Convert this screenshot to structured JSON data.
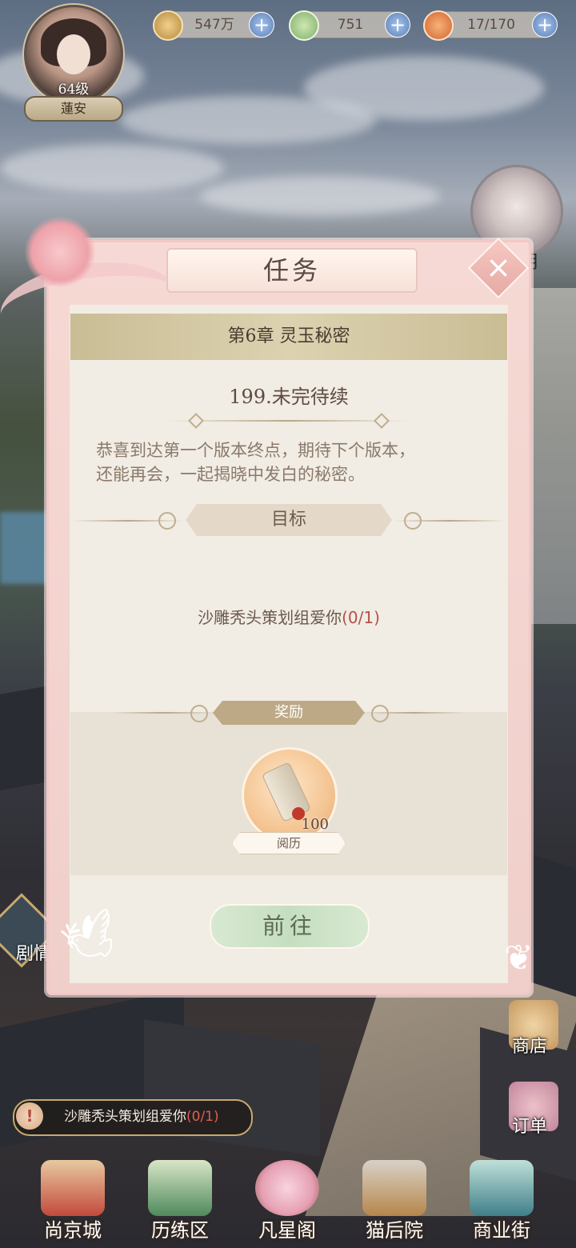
{
  "player": {
    "level": "64级",
    "name": "蓮安"
  },
  "resources": [
    {
      "icon": "paw-coin-icon",
      "value": "547万"
    },
    {
      "icon": "jade-icon",
      "value": "751"
    },
    {
      "icon": "stamina-bowl-icon",
      "value": "17/170"
    }
  ],
  "npc": {
    "label_fragment": "明"
  },
  "dialog": {
    "title": "任务",
    "chapter": "第6章  灵玉秘密",
    "quest_title": "199.未完待续",
    "description": [
      "恭喜到达第一个版本终点，期待下个版本，",
      "还能再会，一起揭晓中发白的秘密。"
    ],
    "goal_header": "目标",
    "goal_text": "沙雕秃头策划组爱你",
    "goal_progress": "(0/1)",
    "reward_header": "奖励",
    "reward": {
      "icon": "scroll-icon",
      "qty": "100",
      "name": "阅历"
    },
    "go_button": "前往"
  },
  "side_buttons": [
    {
      "id": "shop",
      "label": "商店"
    },
    {
      "id": "order",
      "label": "订单"
    }
  ],
  "story_label": "剧情",
  "notice": {
    "text": "沙雕秃头策划组爱你",
    "progress": "(0/1)"
  },
  "nav": [
    {
      "label": "尚京城",
      "color": "#c24a3c"
    },
    {
      "label": "历练区",
      "color": "#4f8a5c"
    },
    {
      "label": "凡星阁",
      "color": "#e6a0b4"
    },
    {
      "label": "猫后院",
      "color": "#b5864b"
    },
    {
      "label": "商业街",
      "color": "#3f7f8a"
    }
  ]
}
